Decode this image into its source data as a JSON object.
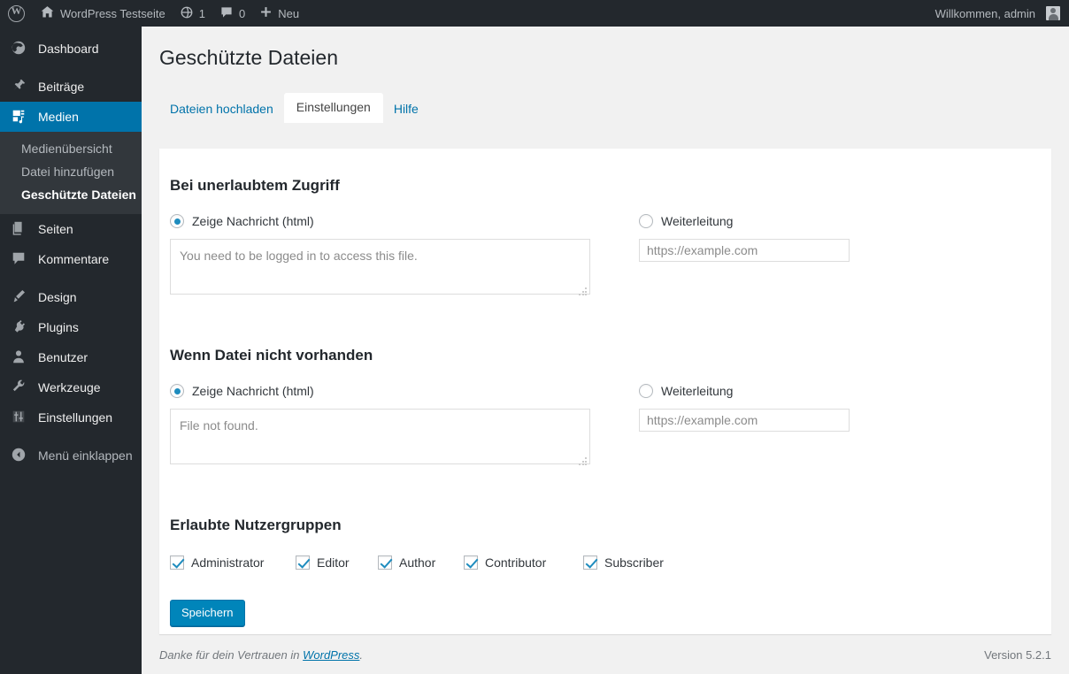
{
  "adminbar": {
    "logo_icon": "wordpress-logo-icon",
    "site_name": "WordPress Testseite",
    "home_icon": "home-icon",
    "updates_icon": "updates-icon",
    "updates_count": "1",
    "comments_icon": "comment-bubble-icon",
    "comments_count": "0",
    "new_icon": "plus-icon",
    "new_label": "Neu",
    "greeting": "Willkommen, admin",
    "avatar_icon": "avatar-icon"
  },
  "sidebar": {
    "items": [
      {
        "label": "Dashboard",
        "icon": "dashboard-icon"
      },
      {
        "label": "Beiträge",
        "icon": "pin-icon"
      },
      {
        "label": "Medien",
        "icon": "media-icon"
      },
      {
        "label": "Seiten",
        "icon": "pages-icon"
      },
      {
        "label": "Kommentare",
        "icon": "comment-icon"
      },
      {
        "label": "Design",
        "icon": "appearance-icon"
      },
      {
        "label": "Plugins",
        "icon": "plugins-icon"
      },
      {
        "label": "Benutzer",
        "icon": "users-icon"
      },
      {
        "label": "Werkzeuge",
        "icon": "tools-icon"
      },
      {
        "label": "Einstellungen",
        "icon": "settings-icon"
      },
      {
        "label": "Menü einklappen",
        "icon": "collapse-icon"
      }
    ],
    "submenu": [
      {
        "label": "Medienübersicht"
      },
      {
        "label": "Datei hinzufügen"
      },
      {
        "label": "Geschützte Dateien"
      }
    ]
  },
  "page": {
    "title": "Geschützte Dateien",
    "tabs": [
      {
        "label": "Dateien hochladen",
        "active": false
      },
      {
        "label": "Einstellungen",
        "active": true
      },
      {
        "label": "Hilfe",
        "active": false
      }
    ]
  },
  "section_unauthorized": {
    "heading": "Bei unerlaubtem Zugriff",
    "radio_message_label": "Zeige Nachricht (html)",
    "message_value": "You need to be logged in to access this file.",
    "radio_redirect_label": "Weiterleitung",
    "redirect_placeholder": "https://example.com",
    "redirect_value": ""
  },
  "section_notfound": {
    "heading": "Wenn Datei nicht vorhanden",
    "radio_message_label": "Zeige Nachricht (html)",
    "message_value": "File not found.",
    "radio_redirect_label": "Weiterleitung",
    "redirect_placeholder": "https://example.com",
    "redirect_value": ""
  },
  "section_roles": {
    "heading": "Erlaubte Nutzergruppen",
    "roles": [
      {
        "label": "Administrator",
        "checked": true
      },
      {
        "label": "Editor",
        "checked": true
      },
      {
        "label": "Author",
        "checked": true
      },
      {
        "label": "Contributor",
        "checked": true
      },
      {
        "label": "Subscriber",
        "checked": true
      }
    ]
  },
  "save_button": "Speichern",
  "footer": {
    "thanks_prefix": "Danke für dein Vertrauen in ",
    "link_label": "WordPress",
    "thanks_suffix": ".",
    "version": "Version 5.2.1"
  },
  "colors": {
    "admin_dark": "#23282d",
    "submenu_dark": "#32373c",
    "accent_blue": "#0073aa",
    "button_blue": "#0085ba",
    "page_bg": "#f1f1f1"
  }
}
